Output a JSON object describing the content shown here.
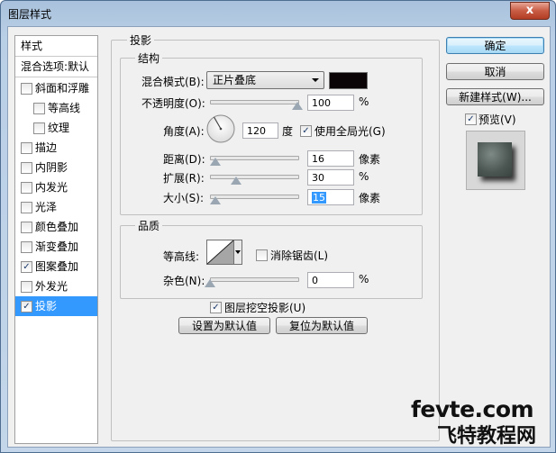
{
  "window": {
    "title": "图层样式",
    "close_glyph": "x"
  },
  "left_list": {
    "header": "样式",
    "blend_options": "混合选项:默认",
    "items": [
      {
        "label": "斜面和浮雕",
        "checked": false
      },
      {
        "label": "等高线",
        "checked": false
      },
      {
        "label": "纹理",
        "checked": false
      },
      {
        "label": "描边",
        "checked": false
      },
      {
        "label": "内阴影",
        "checked": false
      },
      {
        "label": "内发光",
        "checked": false
      },
      {
        "label": "光泽",
        "checked": false
      },
      {
        "label": "颜色叠加",
        "checked": false
      },
      {
        "label": "渐变叠加",
        "checked": false
      },
      {
        "label": "图案叠加",
        "checked": true
      },
      {
        "label": "外发光",
        "checked": false
      },
      {
        "label": "投影",
        "checked": true,
        "selected": true
      }
    ]
  },
  "drop_shadow": {
    "panel_title": "投影",
    "structure": {
      "title": "结构",
      "blend_mode_label": "混合模式(B):",
      "blend_mode_value": "正片叠底",
      "shadow_color": "#0a0406",
      "opacity_label": "不透明度(O):",
      "opacity_value": "100",
      "opacity_unit": "%",
      "opacity_fraction": 1.0,
      "angle_label": "角度(A):",
      "angle_value": "120",
      "angle_unit": "度",
      "global_light_label": "使用全局光(G)",
      "global_light_checked": true,
      "distance_label": "距离(D):",
      "distance_value": "16",
      "distance_unit": "像素",
      "distance_fraction": 0.06,
      "spread_label": "扩展(R):",
      "spread_value": "30",
      "spread_unit": "%",
      "spread_fraction": 0.3,
      "size_label": "大小(S):",
      "size_value": "15",
      "size_unit": "像素",
      "size_fraction": 0.06
    },
    "quality": {
      "title": "品质",
      "contour_label": "等高线:",
      "anti_alias_label": "消除锯齿(L)",
      "anti_alias_checked": false,
      "noise_label": "杂色(N):",
      "noise_value": "0",
      "noise_unit": "%",
      "noise_fraction": 0.0
    },
    "knockout_label": "图层挖空投影(U)",
    "knockout_checked": true,
    "make_default": "设置为默认值",
    "reset_default": "复位为默认值"
  },
  "buttons": {
    "ok": "确定",
    "cancel": "取消",
    "new_style": "新建样式(W)...",
    "preview_label": "预览(V)",
    "preview_checked": true
  },
  "watermark": {
    "line1": "fevte.com",
    "line2": "飞特教程网"
  }
}
